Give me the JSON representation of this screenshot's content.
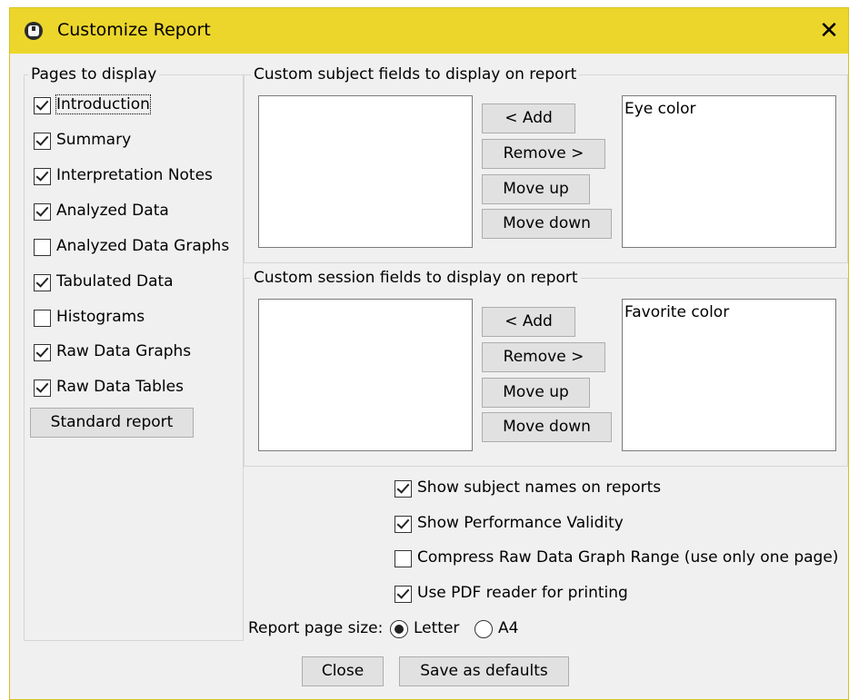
{
  "window": {
    "title": "Customize Report"
  },
  "pages": {
    "label": "Pages to display",
    "items": [
      {
        "label": "Introduction",
        "checked": true
      },
      {
        "label": "Summary",
        "checked": true
      },
      {
        "label": "Interpretation Notes",
        "checked": true
      },
      {
        "label": "Analyzed Data",
        "checked": true
      },
      {
        "label": "Analyzed Data Graphs",
        "checked": false
      },
      {
        "label": "Tabulated Data",
        "checked": true
      },
      {
        "label": "Histograms",
        "checked": false
      },
      {
        "label": "Raw Data Graphs",
        "checked": true
      },
      {
        "label": "Raw Data Tables",
        "checked": true
      }
    ],
    "standard_button": "Standard report"
  },
  "subject_fields": {
    "label": "Custom subject fields to display on report",
    "available": [],
    "selected": [
      "Eye color"
    ],
    "add": "< Add",
    "remove": "Remove >",
    "move_up": "Move up",
    "move_down": "Move down"
  },
  "session_fields": {
    "label": "Custom session fields to display on report",
    "available": [],
    "selected": [
      "Favorite color"
    ],
    "add": "< Add",
    "remove": "Remove >",
    "move_up": "Move up",
    "move_down": "Move down"
  },
  "options": [
    {
      "label": "Show subject names on reports",
      "checked": true
    },
    {
      "label": "Show Performance Validity",
      "checked": true
    },
    {
      "label": "Compress Raw Data Graph Range (use only one page)",
      "checked": false
    },
    {
      "label": "Use PDF reader for printing",
      "checked": true
    }
  ],
  "page_size": {
    "label": "Report page size:",
    "options": [
      {
        "label": "Letter",
        "selected": true
      },
      {
        "label": "A4",
        "selected": false
      }
    ]
  },
  "footer": {
    "close": "Close",
    "save_defaults": "Save as defaults"
  }
}
